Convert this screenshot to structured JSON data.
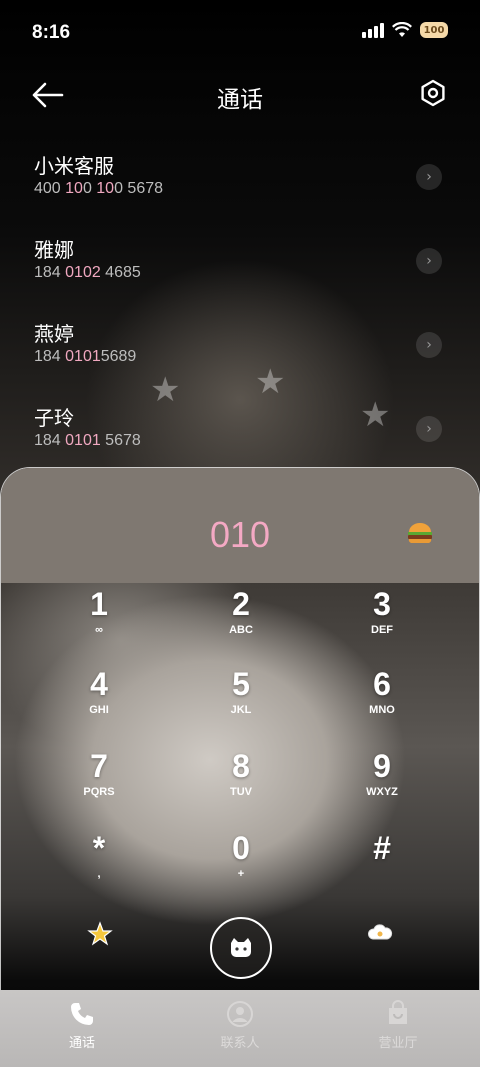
{
  "status_bar": {
    "time": "8:16",
    "battery": "100"
  },
  "header": {
    "title": "通话"
  },
  "contacts": [
    {
      "name": "小米客服",
      "number_parts": [
        "400 ",
        "10",
        "0 ",
        "10",
        "0 5678"
      ]
    },
    {
      "name": "雅娜",
      "number_parts": [
        "184 ",
        "0102",
        " 4685"
      ]
    },
    {
      "name": "燕婷",
      "number_parts": [
        "184 ",
        "0101",
        "5689"
      ]
    },
    {
      "name": "子玲",
      "number_parts": [
        "184 ",
        "0101",
        " 5678"
      ]
    }
  ],
  "dialer": {
    "dialed_number": "010",
    "emoji_button": "burger-icon",
    "keys": [
      {
        "digit": "1",
        "letters": "∞"
      },
      {
        "digit": "2",
        "letters": "ABC"
      },
      {
        "digit": "3",
        "letters": "DEF"
      },
      {
        "digit": "4",
        "letters": "GHI"
      },
      {
        "digit": "5",
        "letters": "JKL"
      },
      {
        "digit": "6",
        "letters": "MNO"
      },
      {
        "digit": "7",
        "letters": "PQRS"
      },
      {
        "digit": "8",
        "letters": "TUV"
      },
      {
        "digit": "9",
        "letters": "WXYZ"
      },
      {
        "digit": "*",
        "letters": ","
      },
      {
        "digit": "0",
        "letters": "+"
      },
      {
        "digit": "#",
        "letters": ""
      }
    ]
  },
  "bottom_nav": {
    "items": [
      {
        "label": "通话",
        "icon": "phone-icon",
        "active": true
      },
      {
        "label": "联系人",
        "icon": "contacts-icon",
        "active": false
      },
      {
        "label": "营业厅",
        "icon": "store-icon",
        "active": false
      }
    ]
  },
  "colors": {
    "highlight": "#f0a8c0",
    "dialed": "#f4a9c4"
  }
}
